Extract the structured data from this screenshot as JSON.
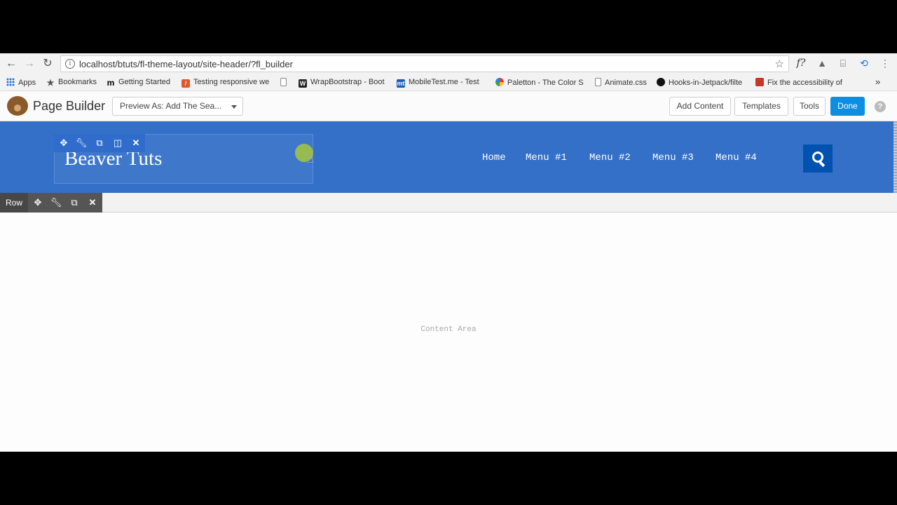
{
  "browser": {
    "url": "localhost/btuts/fl-theme-layout/site-header/?fl_builder",
    "extensions": [
      "f?",
      "▲",
      "⌸",
      "⟲",
      "⋮"
    ]
  },
  "bookmarks": [
    {
      "label": "Apps",
      "icon": "apps-grid-icon"
    },
    {
      "label": "Bookmarks",
      "icon": "star-icon"
    },
    {
      "label": "Getting Started",
      "icon": "m-icon"
    },
    {
      "label": "Testing responsive we",
      "icon": "testing-icon"
    },
    {
      "label": "",
      "icon": "page-icon"
    },
    {
      "label": "WrapBootstrap - Boot",
      "icon": "wrapbootstrap-icon"
    },
    {
      "label": "MobileTest.me - Test",
      "icon": "mobiletest-icon"
    },
    {
      "label": "Paletton - The Color S",
      "icon": "paletton-icon"
    },
    {
      "label": "Animate.css",
      "icon": "page-icon"
    },
    {
      "label": "Hooks-in-Jetpack/filte",
      "icon": "github-icon"
    },
    {
      "label": "Fix the accessibility of",
      "icon": "fix-icon"
    }
  ],
  "page_builder": {
    "title": "Page Builder",
    "preview_as": "Preview As: Add The Sea...",
    "add_content": "Add Content",
    "templates": "Templates",
    "tools": "Tools",
    "done": "Done",
    "help": "?"
  },
  "site_header": {
    "title": "Beaver Tuts",
    "menu": [
      "Home",
      "Menu #1",
      "Menu #2",
      "Menu #3",
      "Menu #4"
    ]
  },
  "row_toolbar": {
    "label": "Row"
  },
  "content": {
    "label": "Content Area"
  },
  "colors": {
    "header_bg": "#3470c7",
    "done_button": "#0d8ee0",
    "search_button": "#0052b0"
  }
}
